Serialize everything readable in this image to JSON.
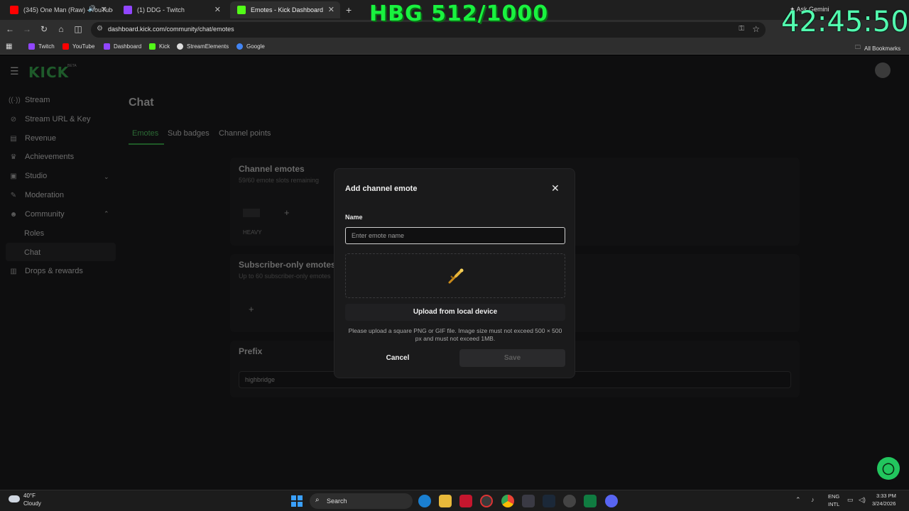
{
  "browser": {
    "tabs": [
      {
        "title": "(345) One Man (Raw) - YouTube",
        "icon_color": "#ff0000"
      },
      {
        "title": "(1) DDG - Twitch",
        "icon_color": "#9146ff"
      },
      {
        "title": "Emotes - Kick Dashboard",
        "icon_color": "#53fc18"
      }
    ],
    "url": "dashboard.kick.com/community/chat/emotes",
    "bookmarks": [
      {
        "label": "Twitch",
        "icon_color": "#9146ff"
      },
      {
        "label": "YouTube",
        "icon_color": "#ff0000"
      },
      {
        "label": "Dashboard",
        "icon_color": "#9146ff"
      },
      {
        "label": "Kick",
        "icon_color": "#53fc18"
      },
      {
        "label": "StreamElements",
        "icon_color": "#dddddd"
      },
      {
        "label": "Google",
        "icon_color": "#4285f4"
      }
    ],
    "all_bookmarks": "All Bookmarks",
    "ask_gemini": "Ask Gemini"
  },
  "overlay": {
    "counter": "HBG 512/1000",
    "timer": "42:45:50"
  },
  "app": {
    "logo": "KICK",
    "logo_badge": "BETA",
    "sidebar": [
      {
        "label": "Stream",
        "icon": "broadcast-icon"
      },
      {
        "label": "Stream URL & Key",
        "icon": "link-icon"
      },
      {
        "label": "Revenue",
        "icon": "revenue-icon"
      },
      {
        "label": "Achievements",
        "icon": "trophy-icon"
      },
      {
        "label": "Studio",
        "icon": "studio-icon"
      },
      {
        "label": "Moderation",
        "icon": "wrench-icon"
      },
      {
        "label": "Community",
        "icon": "community-icon"
      },
      {
        "label": "Drops & rewards",
        "icon": "gift-icon"
      }
    ],
    "sidebar_sub": [
      "Roles",
      "Chat"
    ],
    "page_title": "Chat",
    "page_tabs": [
      "Emotes",
      "Sub badges",
      "Channel points"
    ],
    "channel_emotes": {
      "title": "Channel emotes",
      "subtitle": "59/60 emote slots remaining",
      "emote_name": "HEAVY"
    },
    "subscriber_emotes": {
      "title": "Subscriber-only emotes",
      "subtitle": "Up to 60 subscriber-only emotes"
    },
    "prefix": {
      "title": "Prefix",
      "value": "highbridge"
    }
  },
  "modal": {
    "title": "Add channel emote",
    "name_label": "Name",
    "name_placeholder": "Enter emote name",
    "upload_button": "Upload from local device",
    "upload_note": "Please upload a square PNG or GIF file. Image size must not exceed 500 × 500 px and must not exceed 1MB.",
    "cancel": "Cancel",
    "save": "Save"
  },
  "taskbar": {
    "weather_temp": "40°F",
    "weather_cond": "Cloudy",
    "search": "Search",
    "lang1": "ENG",
    "lang2": "INTL",
    "time": "3:33 PM",
    "date": "3/24/2026"
  }
}
